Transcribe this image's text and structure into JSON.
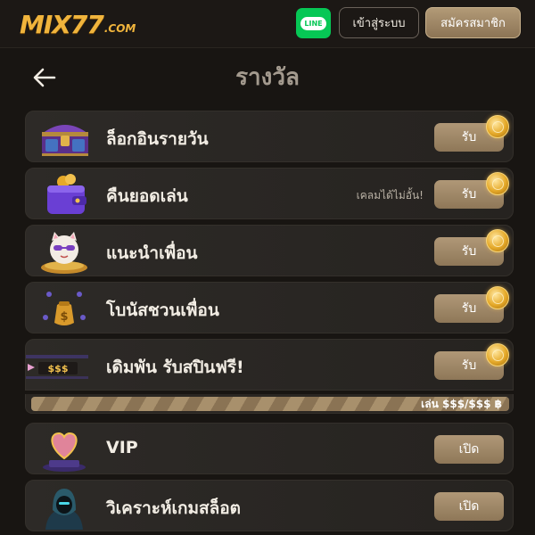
{
  "header": {
    "logo_main": "MIX77",
    "logo_tld": ".COM",
    "line_label": "LINE",
    "login_label": "เข้าสู่ระบบ",
    "register_label": "สมัครสมาชิก"
  },
  "page": {
    "title": "รางวัล"
  },
  "rewards": [
    {
      "label": "ล็อกอินรายวัน",
      "button": "รับ",
      "icon": "treasure-chest-icon"
    },
    {
      "label": "คืนยอดเล่น",
      "note": "เคลมได้ไม่อั้น!",
      "button": "รับ",
      "icon": "wallet-icon"
    },
    {
      "label": "แนะนำเพื่อน",
      "button": "รับ",
      "icon": "lucky-cat-icon"
    },
    {
      "label": "โบนัสชวนเพื่อน",
      "button": "รับ",
      "icon": "money-bag-icon"
    },
    {
      "label": "เดิมพัน รับสปินฟรี!",
      "button": "รับ",
      "icon": "slot-ticket-icon",
      "ticket_text": "$$$"
    }
  ],
  "progress": {
    "text": "เล่น $$$/$$$ ฿",
    "fraction": 1.0
  },
  "features": [
    {
      "label": "VIP",
      "button": "เปิด",
      "icon": "vip-heart-icon"
    },
    {
      "label": "วิเคราะห์เกมสล็อต",
      "button": "เปิด",
      "icon": "hooded-analyst-icon"
    }
  ],
  "colors": {
    "accent_gold": "#f0b43c",
    "button_tan": "#a08866",
    "line_green": "#06c755",
    "background": "#181512"
  }
}
